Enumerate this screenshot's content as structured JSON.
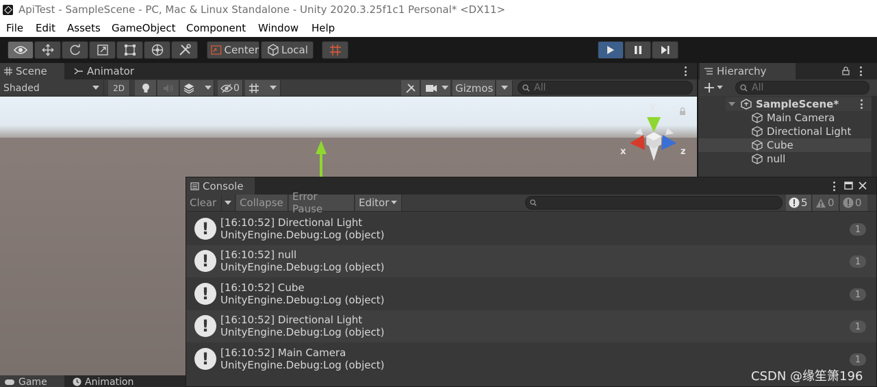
{
  "window": {
    "title": "ApiTest - SampleScene - PC, Mac & Linux Standalone - Unity 2020.3.25f1c1 Personal* <DX11>"
  },
  "menu": [
    "File",
    "Edit",
    "Assets",
    "GameObject",
    "Component",
    "Window",
    "Help"
  ],
  "toolbar": {
    "pivot_label": "Center",
    "space_label": "Local"
  },
  "scene": {
    "tabs": [
      "Scene",
      "Animator"
    ],
    "shading_mode": "Shaded",
    "mode_2d": "2D",
    "hidden_count": "0",
    "gizmos_label": "Gizmos",
    "search_placeholder": "All",
    "axis_labels": {
      "x": "x",
      "y": "y",
      "z": "z"
    }
  },
  "hierarchy": {
    "tab_label": "Hierarchy",
    "search_placeholder": "All",
    "scene_name": "SampleScene*",
    "items": [
      "Main Camera",
      "Directional Light",
      "Cube",
      "null"
    ],
    "selected_index": 2
  },
  "console": {
    "tab_label": "Console",
    "buttons": {
      "clear": "Clear",
      "collapse": "Collapse",
      "error_pause": "Error Pause",
      "editor": "Editor"
    },
    "counts": {
      "log": "5",
      "warning": "0",
      "error": "0"
    },
    "entries": [
      {
        "line1": "[16:10:52] Directional Light",
        "line2": "UnityEngine.Debug:Log (object)",
        "count": "1"
      },
      {
        "line1": "[16:10:52] null",
        "line2": "UnityEngine.Debug:Log (object)",
        "count": "1"
      },
      {
        "line1": "[16:10:52] Cube",
        "line2": "UnityEngine.Debug:Log (object)",
        "count": "1"
      },
      {
        "line1": "[16:10:52] Directional Light",
        "line2": "UnityEngine.Debug:Log (object)",
        "count": "1"
      },
      {
        "line1": "[16:10:52] Main Camera",
        "line2": "UnityEngine.Debug:Log (object)",
        "count": "1"
      }
    ]
  },
  "bottom_tabs": [
    "Game",
    "Animation"
  ],
  "watermark": "CSDN @缘笙箫196",
  "colors": {
    "play_button": "#3c5f8c",
    "gizmo_x": "#d63a2a",
    "gizmo_y": "#8fd630",
    "gizmo_z": "#3a6fd6"
  }
}
